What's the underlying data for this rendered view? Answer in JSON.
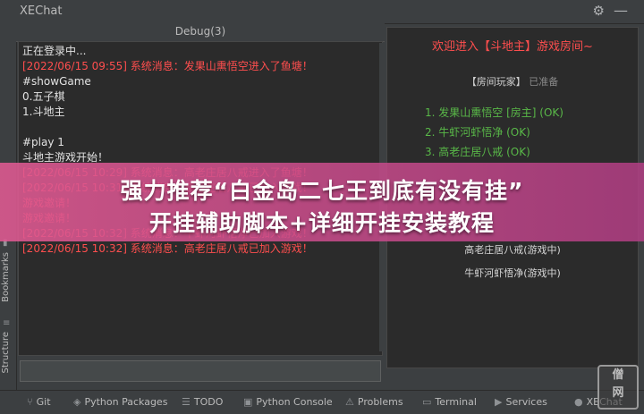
{
  "window": {
    "title": "XEChat"
  },
  "debug_panel": {
    "tab_title": "Debug(3)",
    "lines": [
      {
        "text": "正在登录中...",
        "color": "white"
      },
      {
        "text": "[2022/06/15 09:55] 系统消息：发果山熏悟空进入了鱼塘！",
        "color": "red"
      },
      {
        "text": "#showGame",
        "color": "white"
      },
      {
        "text": "0.五子棋",
        "color": "white"
      },
      {
        "text": "1.斗地主",
        "color": "white"
      },
      {
        "text": "",
        "color": "white"
      },
      {
        "text": "#play 1",
        "color": "white"
      },
      {
        "text": "斗地主游戏开始！",
        "color": "white"
      },
      {
        "text": "[2022/06/15 10:29] 系统消息：高老庄居八戒进入了鱼塘！",
        "color": "red"
      },
      {
        "text": "[2022/06/15 10:31] 系统消息：高老庄居八戒已加入游戏！",
        "color": "red"
      },
      {
        "text": "游戏邀请！",
        "color": "red"
      },
      {
        "text": "游戏邀请！",
        "color": "red"
      },
      {
        "text": "[2022/06/15 10:32] 系统消息：牛虾河虾悟净已加入游戏！",
        "color": "red"
      },
      {
        "text": "[2022/06/15 10:32] 系统消息：高老庄居八戒已加入游戏！",
        "color": "red"
      }
    ]
  },
  "room_panel": {
    "title": "欢迎进入【斗地主】游戏房间~",
    "players_label": "【房间玩家】",
    "players_status": "已准备",
    "players": [
      "1. 发果山熏悟空 [房主] (OK)",
      "2. 牛虾河虾悟净 (OK)",
      "3. 高老庄居八戒 (OK)"
    ],
    "in_game": [
      "高老庄居八戒(游戏中)",
      "牛虾河虾悟净(游戏中)"
    ]
  },
  "left_toolbar": {
    "bookmarks": "Bookmarks",
    "structure": "Structure"
  },
  "status_bar": {
    "items": [
      "Git",
      "Python Packages",
      "TODO",
      "Python Console",
      "Problems",
      "Terminal",
      "Services",
      "XEChat"
    ]
  },
  "banner": {
    "line1": "强力推荐“白金岛二七王到底有没有挂”",
    "line2": "开挂辅助脚本+详细开挂安装教程"
  },
  "watermark": {
    "line1": "僧",
    "line2": "网"
  },
  "colors": {
    "console_bg": "#2b2b2b",
    "system_message": "#ff4e4e",
    "player_ok": "#59b848",
    "banner": "#e05a92"
  }
}
